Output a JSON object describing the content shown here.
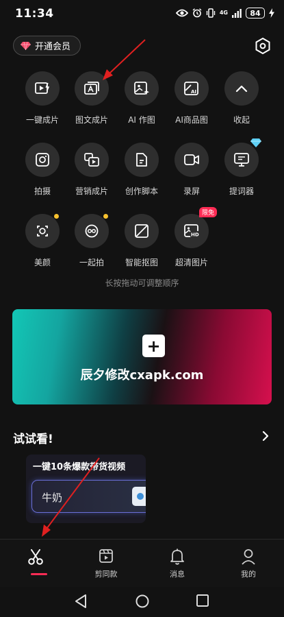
{
  "status_bar": {
    "time": "11:34",
    "network": "4G",
    "battery": "84"
  },
  "header": {
    "vip_label": "开通会员"
  },
  "tools": [
    {
      "label": "一键成片"
    },
    {
      "label": "图文成片"
    },
    {
      "label": "AI 作图"
    },
    {
      "label": "AI商品图"
    },
    {
      "label": "收起"
    },
    {
      "label": "拍摄"
    },
    {
      "label": "营销成片"
    },
    {
      "label": "创作脚本"
    },
    {
      "label": "录屏"
    },
    {
      "label": "提词器"
    },
    {
      "label": "美颜"
    },
    {
      "label": "一起拍"
    },
    {
      "label": "智能抠图"
    },
    {
      "label": "超清图片",
      "badge": "限免"
    }
  ],
  "hint": "长按拖动可调整顺序",
  "banner": {
    "plus": "+",
    "text": "辰夕修改cxapk.com"
  },
  "section": {
    "title": "试试看!"
  },
  "card": {
    "title": "一键10条爆款带货视频",
    "input_text": "牛奶"
  },
  "tabbar": {
    "items": [
      {
        "label": ""
      },
      {
        "label": "剪同款"
      },
      {
        "label": "消息"
      },
      {
        "label": "我的"
      }
    ]
  },
  "colors": {
    "accent": "#fe2c55",
    "background": "#121212",
    "tool_circle": "#2e2e2e",
    "dot": "#f7c12e"
  }
}
